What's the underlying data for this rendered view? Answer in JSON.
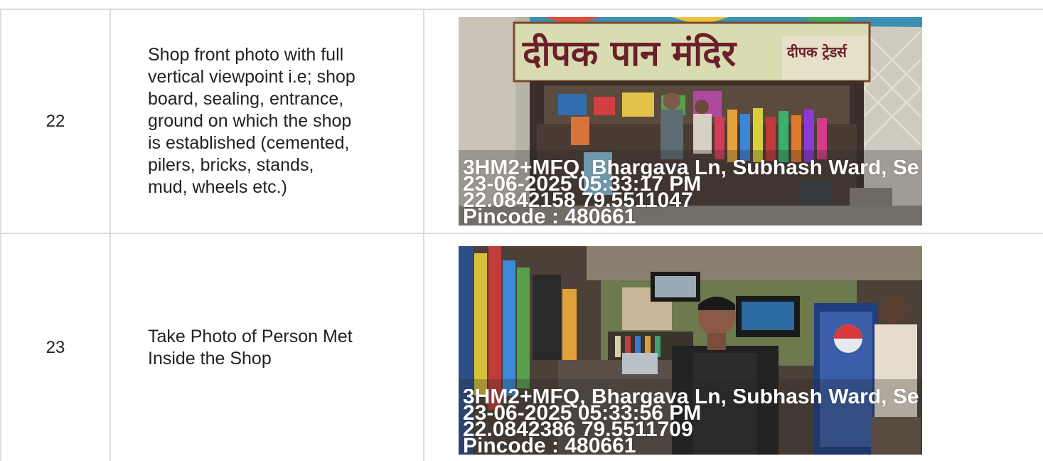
{
  "rows": [
    {
      "number": "22",
      "description_lines": [
        "Shop front photo with full",
        "vertical viewpoint i.e; shop",
        "board, sealing, entrance,",
        "ground on which the shop",
        "is established (cemented,",
        "pilers, bricks, stands,",
        "mud, wheels etc.)"
      ],
      "photo": {
        "sign_text": "दीपक पान मंदिर",
        "sign_side_text": "दीपक ट्रेडर्स",
        "stamp": {
          "address": "3HM2+MFQ, Bhargava Ln, Subhash Ward, Se",
          "datetime": "23-06-2025 05:33:17 PM",
          "coords": "22.0842158 79.5511047",
          "pincode": "Pincode : 480661"
        }
      }
    },
    {
      "number": "23",
      "description_lines": [
        "Take Photo of Person Met",
        "Inside the Shop"
      ],
      "photo": {
        "stamp": {
          "address": "3HM2+MFQ, Bhargava Ln, Subhash Ward, Se",
          "datetime": "23-06-2025 05:33:56 PM",
          "coords": "22.0842386 79.5511709",
          "pincode": "Pincode : 480661"
        }
      }
    }
  ],
  "colors": {
    "grid": "#dcdcdc",
    "text": "#222222",
    "stamp_text": "#ffffff",
    "sign_text": "#6a1f2b"
  }
}
